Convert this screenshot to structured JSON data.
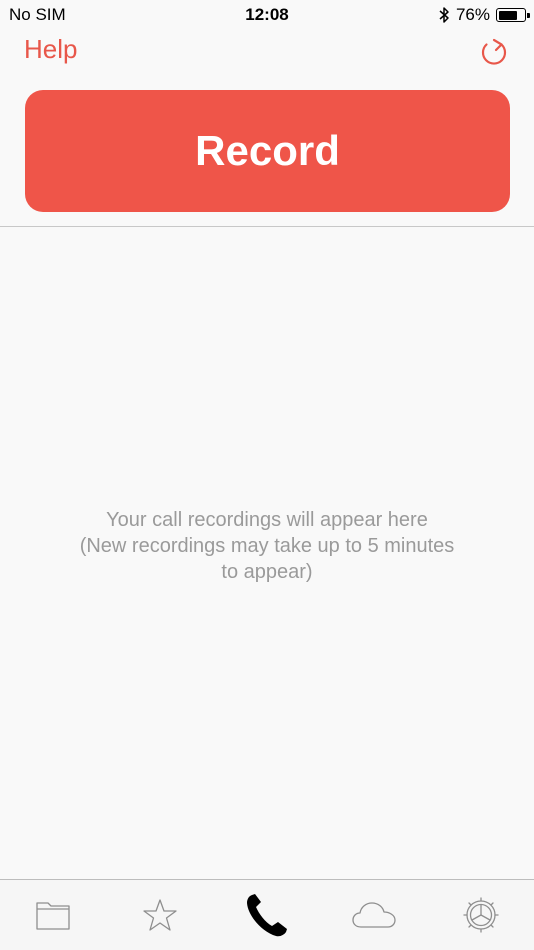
{
  "status_bar": {
    "carrier": "No SIM",
    "time": "12:08",
    "battery_percent": "76%",
    "battery_level": 0.76,
    "bluetooth_icon": "bluetooth-icon"
  },
  "nav": {
    "help_label": "Help",
    "refresh_icon": "refresh-icon"
  },
  "record_button": {
    "label": "Record"
  },
  "empty_state": {
    "line1": "Your call recordings will appear here",
    "line2": "(New recordings may take up to 5 minutes",
    "line3": "to appear)"
  },
  "tab_bar": {
    "tabs": [
      {
        "icon": "folder-icon",
        "selected": false
      },
      {
        "icon": "star-icon",
        "selected": false
      },
      {
        "icon": "phone-icon",
        "selected": true
      },
      {
        "icon": "cloud-icon",
        "selected": false
      },
      {
        "icon": "settings-icon",
        "selected": false
      }
    ]
  },
  "colors": {
    "accent": "#e8574a",
    "record_button": "#ef5549",
    "muted_text": "#9a9a9a",
    "tab_icon_inactive": "#8e8e8e",
    "tab_icon_active": "#000000"
  }
}
